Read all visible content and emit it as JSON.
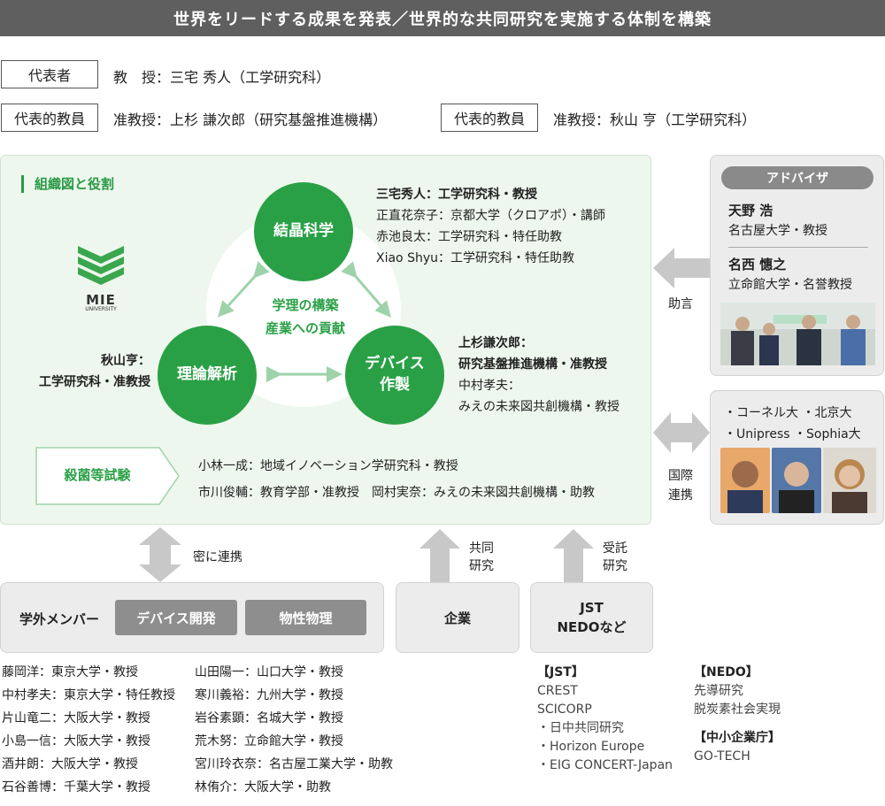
{
  "banner": "世界をリードする成果を発表／世界的な共同研究を実施する体制を構築",
  "header": {
    "rep_tag": "代表者",
    "rep_value": "教　授：三宅 秀人（工学研究科）",
    "member1_tag": "代表的教員",
    "member1_value": "准教授：上杉 謙次郎（研究基盤推進機構）",
    "member2_tag": "代表的教員",
    "member2_value": "准教授：秋山 亨（工学研究科）"
  },
  "org": {
    "title": "組織図と役割",
    "logo_text": "MIE",
    "logo_sub": "UNIVERSITY",
    "circle_crystal": "結晶科学",
    "circle_theory": "理論解析",
    "circle_device_1": "デバイス",
    "circle_device_2": "作製",
    "center_1": "学理の構築",
    "center_2": "産業への貢献",
    "crystal_members": [
      "三宅秀人：工学研究科・教授",
      "正直花奈子：京都大学（クロアポ）・講師",
      "赤池良太：工学研究科・特任助教",
      "Xiao Shyu：工学研究科・特任助教"
    ],
    "theory_member_1": "秋山亨：",
    "theory_member_2": "工学研究科・准教授",
    "device_members": [
      "上杉謙次郎：",
      "研究基盤推進機構・准教授",
      "中村孝夫：",
      "みえの未来図共創機構・教授"
    ],
    "sterilization_label": "殺菌等試験",
    "sterilization_1": "小林一成：地域イノベーション学研究科・教授",
    "sterilization_2": "市川俊輔：教育学部・准教授　岡村実奈：みえの未来図共創機構・助教"
  },
  "advisor": {
    "head": "アドバイザ",
    "name1": "天野 浩",
    "aff1": "名古屋大学・教授",
    "name2": "名西 憓之",
    "aff2": "立命館大学・名誉教授",
    "arrow_label": "助言"
  },
  "international": {
    "line1": "・コーネル大  ・北京大",
    "line2": "・Unipress  ・Sophia大",
    "arrow_label_1": "国際",
    "arrow_label_2": "連携"
  },
  "bottom": {
    "close_link": "密に連携",
    "joint_1": "共同",
    "joint_2": "研究",
    "contract_1": "受託",
    "contract_2": "研究",
    "external_label": "学外メンバー",
    "btn_device": "デバイス開発",
    "btn_physics": "物性物理",
    "company": "企業",
    "jst_1": "JST",
    "jst_2": "NEDOなど"
  },
  "members_left": [
    "藤岡洋：東京大学・教授",
    "中村孝夫：東京大学・特任教授",
    "片山竜二：大阪大学・教授",
    "小島一信：大阪大学・教授",
    "酒井朗：大阪大学・教授",
    "石谷善博：千葉大学・教授"
  ],
  "members_right": [
    "山田陽一：山口大学・教授",
    "寒川義裕：九州大学・教授",
    "岩谷素顕：名城大学・教授",
    "荒木努：立命館大学・教授",
    "宮川玲衣奈：名古屋工業大学・助教",
    "林侑介：大阪大学・助教"
  ],
  "programs_jst": [
    "【JST】",
    "CREST",
    "SCICORP",
    "・日中共同研究",
    "・Horizon Europe",
    "・EIG CONCERT-Japan"
  ],
  "programs_nedo": [
    "【NEDO】",
    "先導研究",
    "脱炭素社会実現"
  ],
  "programs_sme": [
    "【中小企業庁】",
    "GO-TECH"
  ],
  "colors": {
    "green": "#2aa046",
    "banner": "#5f5f5f",
    "light_green": "#eef7ee",
    "arrow_gray": "#c8c8c8"
  }
}
